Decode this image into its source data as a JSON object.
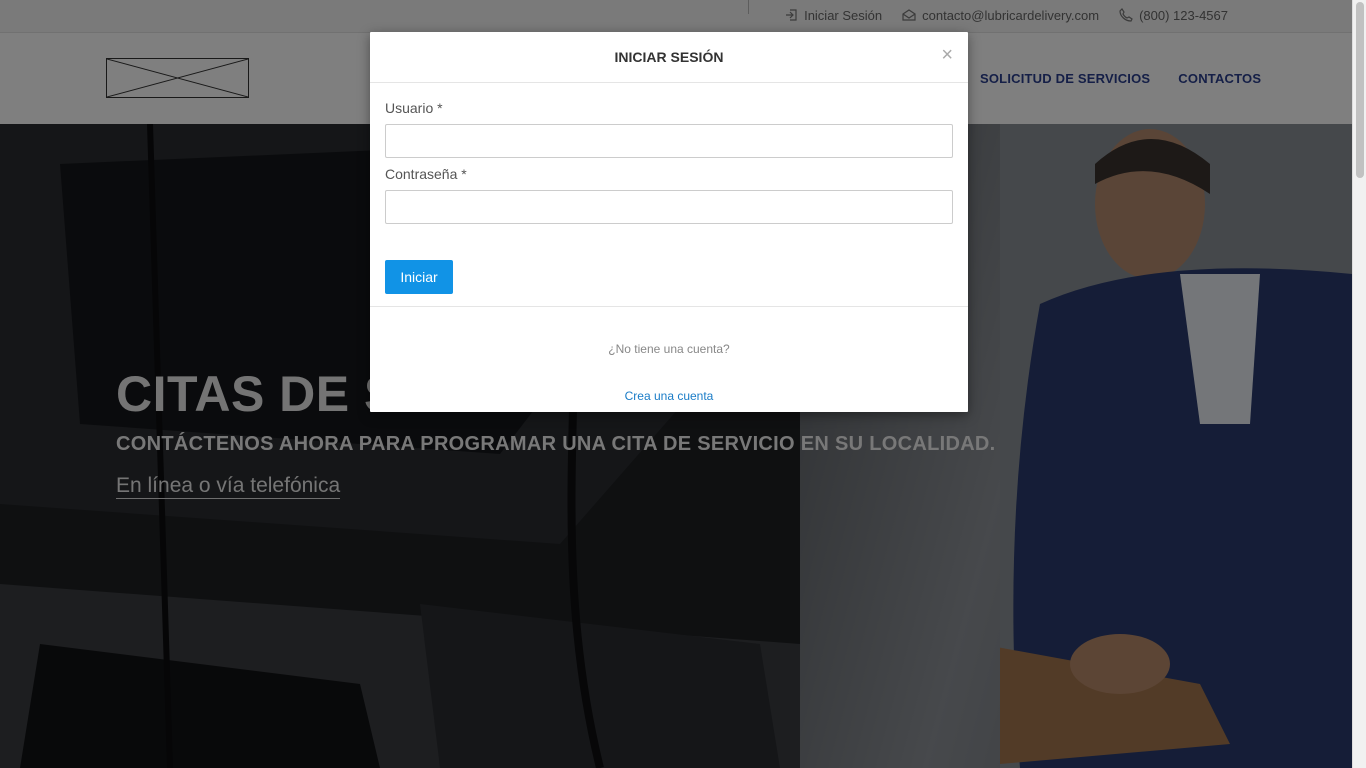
{
  "topbar": {
    "login_label": "Iniciar Sesión",
    "email": "contacto@lubricardelivery.com",
    "phone": "(800) 123-4567",
    "icons": [
      "login-icon",
      "envelope-icon",
      "phone-icon"
    ]
  },
  "header": {
    "nav": [
      "SOLICITUD DE SERVICIOS",
      "CONTACTOS"
    ]
  },
  "hero": {
    "title": "CITAS DE SERVICIO",
    "subtitle": "CONTÁCTENOS AHORA PARA PROGRAMAR UNA CITA DE SERVICIO EN SU LOCALIDAD.",
    "link": "En línea o vía telefónica"
  },
  "modal": {
    "title": "INICIAR SESIÓN",
    "close": "×",
    "username_label": "Usuario *",
    "username_value": "",
    "password_label": "Contraseña *",
    "password_value": "",
    "submit_label": "Iniciar",
    "no_account": "¿No tiene una cuenta?",
    "create_account": "Crea una cuenta"
  },
  "colors": {
    "nav": "#2a3f8f",
    "button": "#1193e6",
    "link": "#1a7cc7"
  }
}
